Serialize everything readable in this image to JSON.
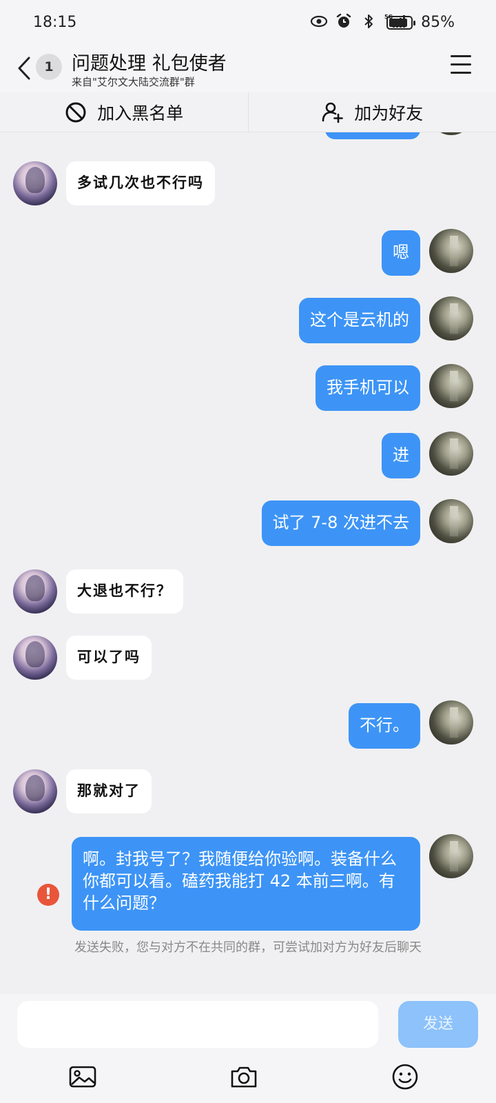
{
  "status_bar": {
    "time": "18:15",
    "battery_percent": "85%",
    "battery_level": 0.85,
    "icons": [
      "eye-icon",
      "alarm-icon",
      "bluetooth-icon",
      "5g-signal-icon",
      "battery-icon"
    ]
  },
  "header": {
    "unread_count": "1",
    "title": "问题处理 礼包使者",
    "subtitle": "来自\"艾尔文大陆交流群\"群"
  },
  "actions": {
    "blacklist_label": "加入黑名单",
    "add_friend_label": "加为好友"
  },
  "messages": [
    {
      "from": "other",
      "text": "多试几次也不行吗"
    },
    {
      "from": "me",
      "text": "嗯"
    },
    {
      "from": "me",
      "text": "这个是云机的"
    },
    {
      "from": "me",
      "text": "我手机可以"
    },
    {
      "from": "me",
      "text": "进"
    },
    {
      "from": "me",
      "text": "试了 7-8 次进不去"
    },
    {
      "from": "other",
      "text": "大退也不行？"
    },
    {
      "from": "other",
      "text": "可以了吗"
    },
    {
      "from": "me",
      "text": "不行。"
    },
    {
      "from": "other",
      "text": "那就对了"
    },
    {
      "from": "me",
      "text": "啊。封我号了？我随便给你验啊。装备什么你都可以看。磕药我能打 42 本前三啊。有什么问题？",
      "failed": true
    }
  ],
  "fail_notice": "发送失败，您与对方不在共同的群，可尝试加对方为好友后聊天",
  "composer": {
    "input_value": "",
    "send_label": "发送"
  },
  "toolbar_icons": [
    "image-icon",
    "camera-icon",
    "emoji-icon"
  ],
  "colors": {
    "my_bubble": "#3d94f6",
    "their_bubble": "#ffffff",
    "background": "#f0f0f2",
    "send_disabled": "#8dc2fa",
    "error": "#e8553b"
  }
}
